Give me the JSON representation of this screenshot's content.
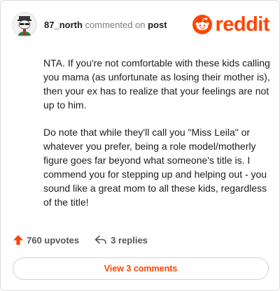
{
  "comment": {
    "username": "87_north",
    "action_text": " commented on ",
    "target_link": "post",
    "paragraphs": [
      "NTA. If you're not comfortable with these kids calling you mama (as unfortunate as losing their mother is), then your ex has to realize that your feelings are not up to him.",
      "Do note that while they'll call you \"Miss Leila\" or whatever you prefer, being a role model/motherly figure goes far beyond what someone's title is. I commend you for stepping up and helping out - you sound like a great mom to all these kids, regardless of the title!"
    ]
  },
  "brand": {
    "wordmark": "reddit",
    "color": "#ff4500"
  },
  "stats": {
    "upvotes": "760 upvotes",
    "replies": "3 replies"
  },
  "footer": {
    "view_comments_label": "View 3 comments"
  },
  "icons": {
    "avatar": "snoo-avatar",
    "logo": "reddit-alien-icon",
    "upvote": "upvote-arrow-icon",
    "reply": "reply-arrow-icon"
  }
}
